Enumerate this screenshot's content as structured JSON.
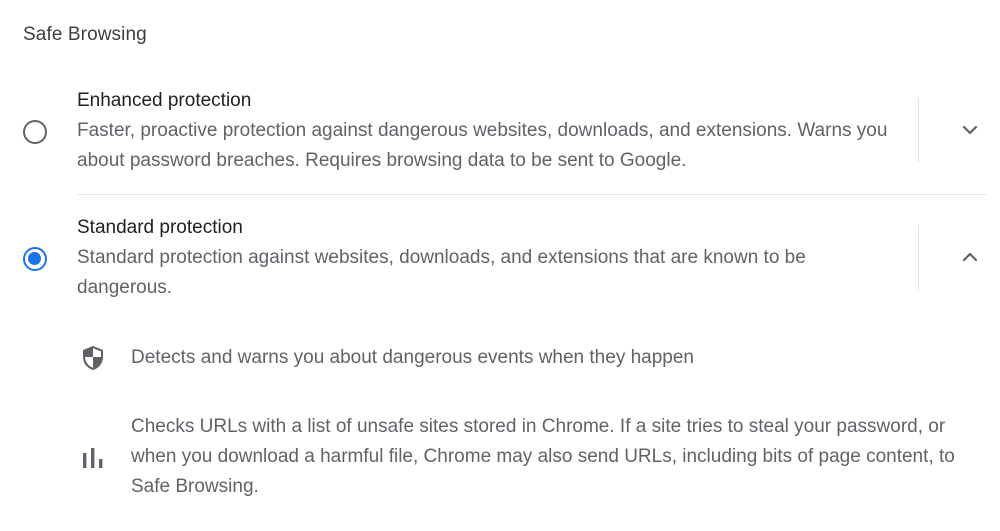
{
  "section": {
    "title": "Safe Browsing"
  },
  "options": [
    {
      "title": "Enhanced protection",
      "description": "Faster, proactive protection against dangerous websites, downloads, and extensions. Warns you about password breaches. Requires browsing data to be sent to Google.",
      "selected": false,
      "expanded": false
    },
    {
      "title": "Standard protection",
      "description": "Standard protection against websites, downloads, and extensions that are known to be dangerous.",
      "selected": true,
      "expanded": true
    }
  ],
  "standard_details": [
    {
      "icon": "shield-icon",
      "text": "Detects and warns you about dangerous events when they happen"
    },
    {
      "icon": "bar-chart-icon",
      "text": "Checks URLs with a list of unsafe sites stored in Chrome. If a site tries to steal your password, or when you download a harmful file, Chrome may also send URLs, including bits of page content, to Safe Browsing."
    }
  ],
  "colors": {
    "accent": "#1a73e8",
    "text_primary": "#202124",
    "text_secondary": "#5f6368"
  }
}
